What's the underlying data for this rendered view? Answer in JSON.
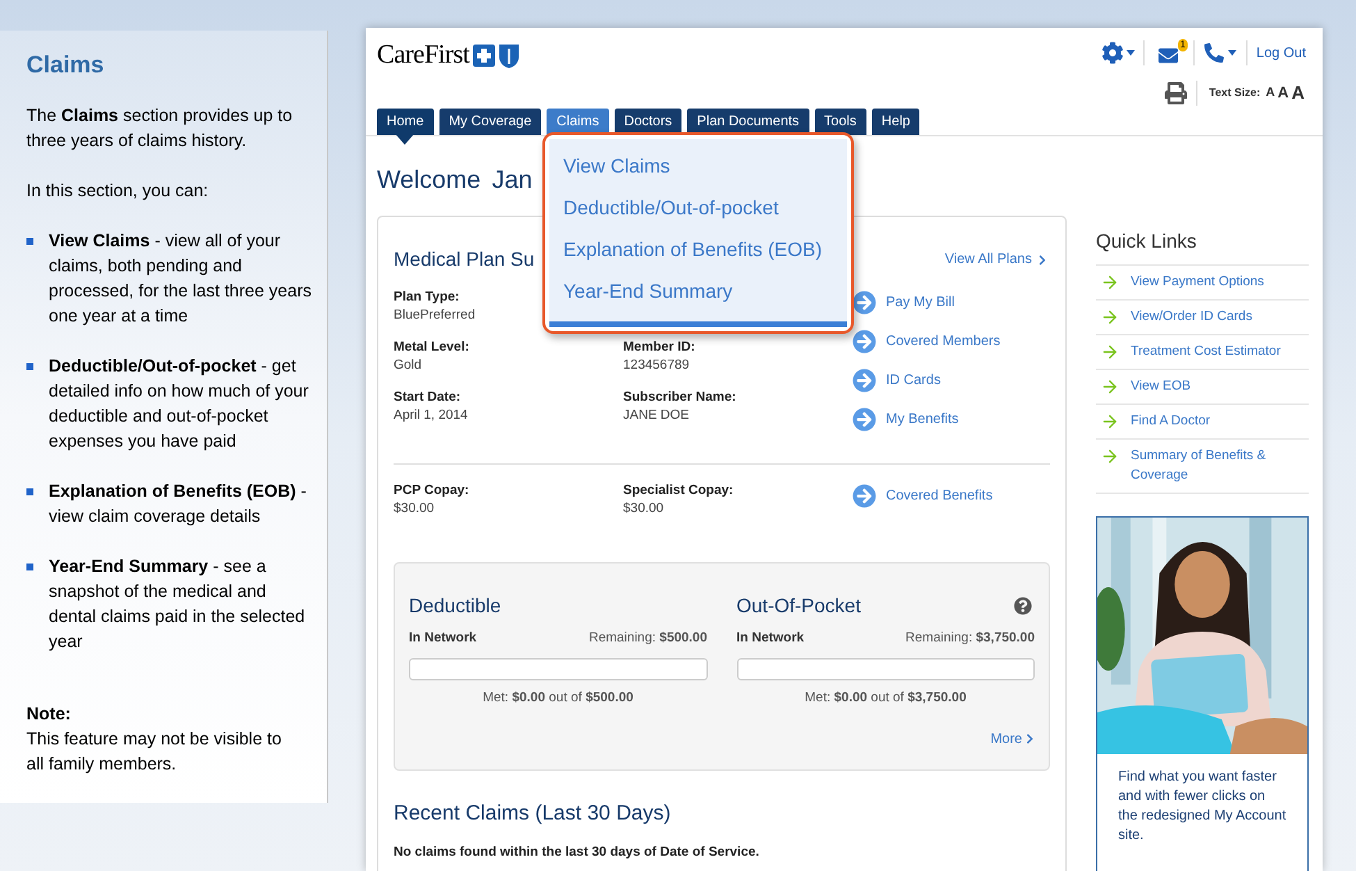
{
  "sidebar": {
    "title": "Claims",
    "intro": "The **Claims** section provides up to three years of claims history.",
    "lead": "In this section, you can:",
    "items": [
      "**View Claims** - view all of your claims, both pending and processed, for the last three years one year at a time",
      "**Deductible/Out-of-pocket** - get detailed info on how much of your deductible and out-of-pocket expenses you have paid",
      "**Explanation of Benefits (EOB)** - view claim coverage details",
      "**Year-End Summary** - see a snapshot of the medical and dental claims paid in the selected year"
    ],
    "note_label": "Note:",
    "note": "This feature may not be visible to all family members."
  },
  "header": {
    "logo": "CareFirst",
    "mail_count": "1",
    "logout": "Log Out",
    "text_size_label": "Text Size:",
    "text_sizes": [
      "A",
      "A",
      "A"
    ]
  },
  "nav": [
    {
      "label": "Home",
      "selected": true,
      "expanded": false
    },
    {
      "label": "My Coverage",
      "selected": false,
      "expanded": false
    },
    {
      "label": "Claims",
      "selected": false,
      "expanded": true
    },
    {
      "label": "Doctors",
      "selected": false,
      "expanded": false
    },
    {
      "label": "Plan Documents",
      "selected": false,
      "expanded": false
    },
    {
      "label": "Tools",
      "selected": false,
      "expanded": false
    },
    {
      "label": "Help",
      "selected": false,
      "expanded": false
    }
  ],
  "claims_menu": [
    "View Claims",
    "Deductible/Out-of-pocket",
    "Explanation of Benefits (EOB)",
    "Year-End Summary"
  ],
  "welcome": {
    "greeting": "Welcome",
    "name": "Jan"
  },
  "plan_summary": {
    "title": "Medical Plan Su",
    "view_all": "View All Plans",
    "rows": [
      [
        {
          "label": "Plan Type:",
          "value": "BluePreferred"
        }
      ],
      [
        {
          "label": "Metal Level:",
          "value": "Gold"
        },
        {
          "label": "Member ID:",
          "value": "123456789"
        }
      ],
      [
        {
          "label": "Start Date:",
          "value": "April 1, 2014"
        },
        {
          "label": "Subscriber Name:",
          "value": "JANE DOE"
        }
      ]
    ],
    "links": [
      "Pay My Bill",
      "Covered Members",
      "ID Cards",
      "My Benefits"
    ],
    "copays": [
      {
        "label": "PCP Copay:",
        "value": "$30.00"
      },
      {
        "label": "Specialist Copay:",
        "value": "$30.00"
      }
    ],
    "copay_link": "Covered Benefits"
  },
  "meters": [
    {
      "title": "Deductible",
      "network": "In Network",
      "remaining": "Remaining: **$500.00**",
      "level": 0,
      "met": "Met: **$0.00** out of **$500.00**",
      "help": false
    },
    {
      "title": "Out-Of-Pocket",
      "network": "In Network",
      "remaining": "Remaining: **$3,750.00**",
      "level": 0,
      "met": "Met: **$0.00** out of **$3,750.00**",
      "help": true
    }
  ],
  "more": "More",
  "recent_claims": {
    "title": "Recent Claims (Last 30 Days)",
    "message": "No claims found within the last 30 days of Date of Service."
  },
  "quick_links": {
    "title": "Quick Links",
    "items": [
      "View Payment Options",
      "View/Order ID Cards",
      "Treatment Cost Estimator",
      "View EOB",
      "Find A Doctor",
      "Summary of Benefits & Coverage"
    ]
  },
  "promo": {
    "kind": "picture",
    "text": "Find what you want faster and with fewer clicks on the redesigned My Account site."
  }
}
